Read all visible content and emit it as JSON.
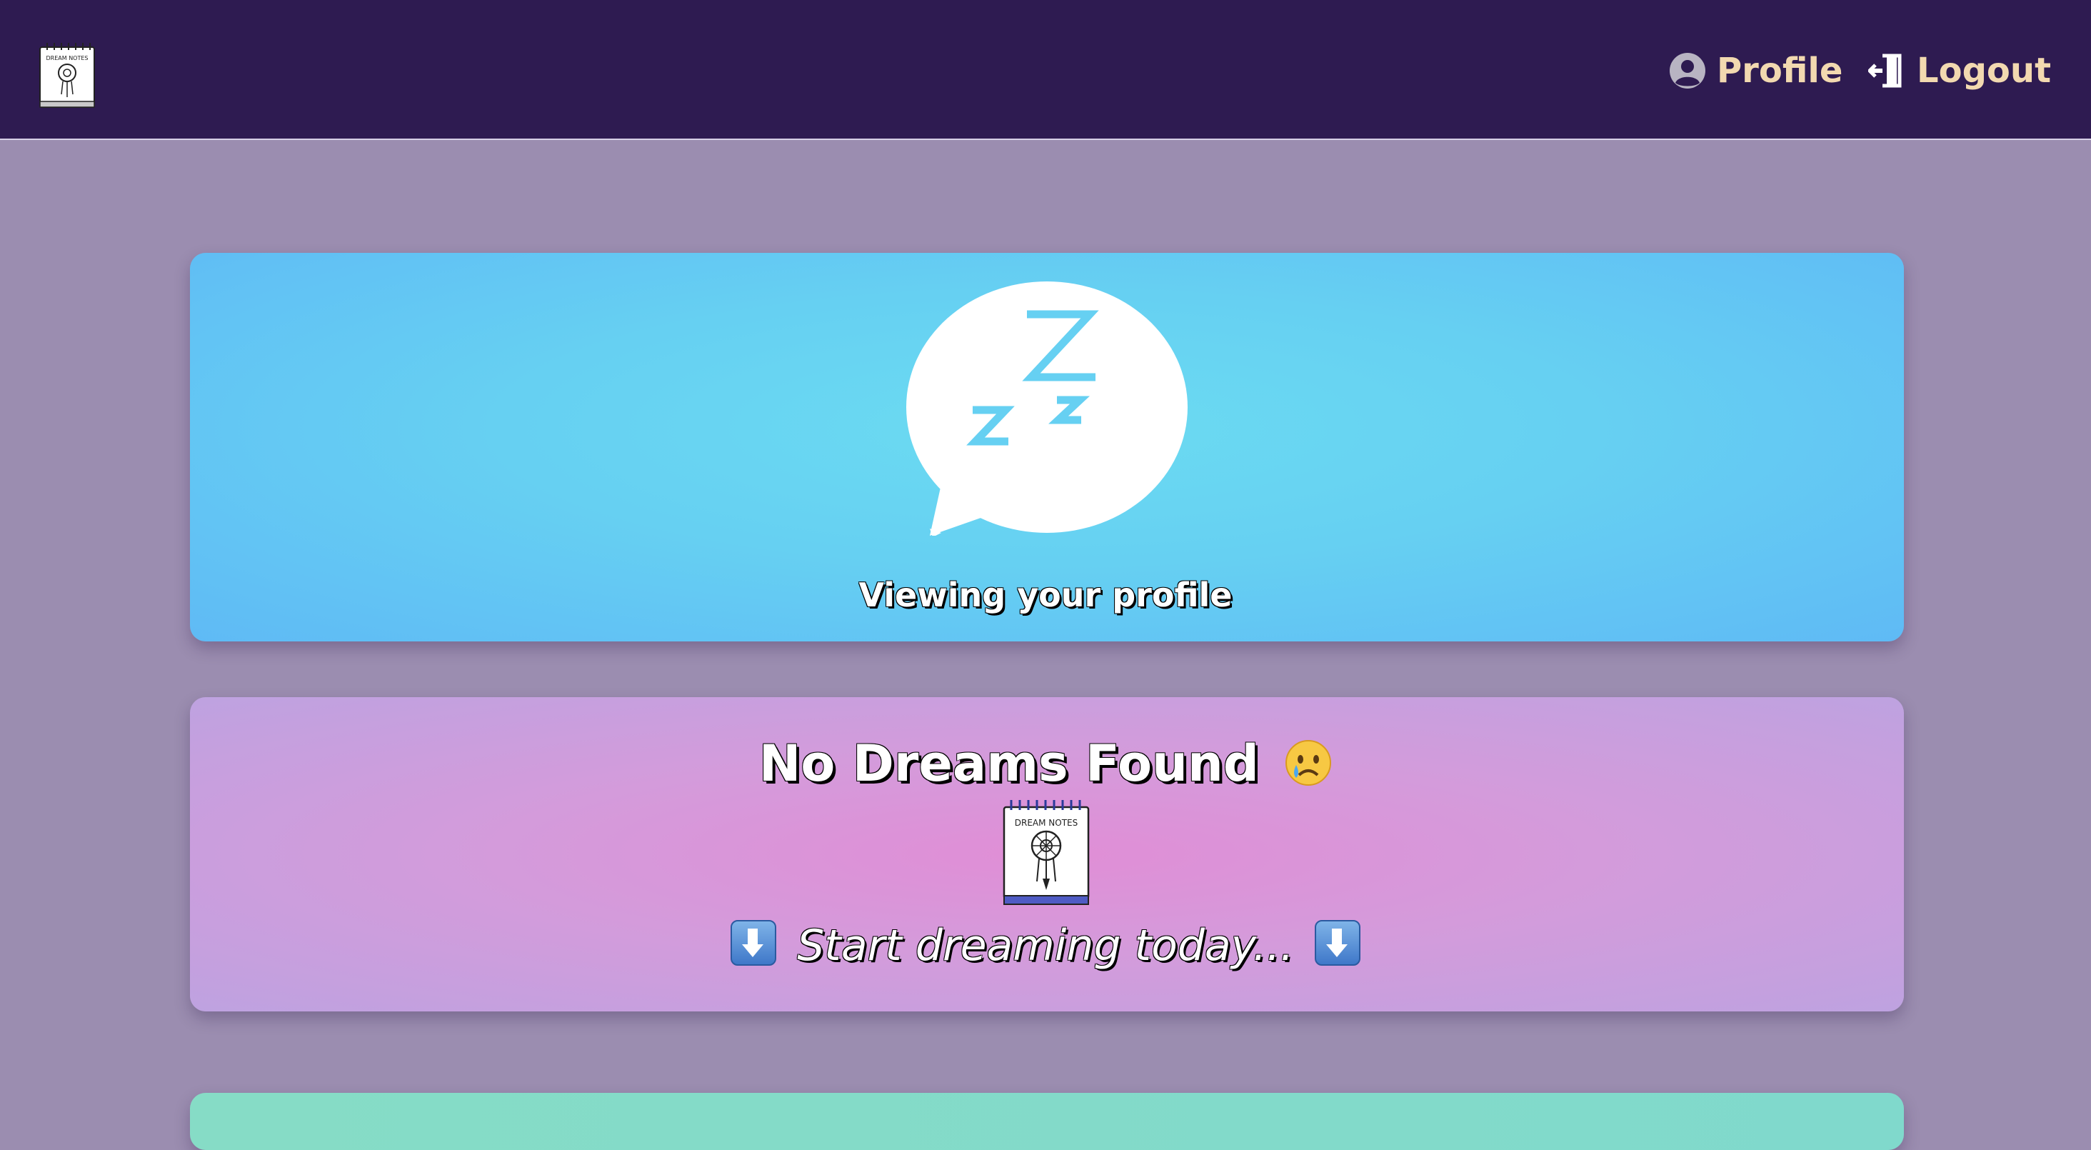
{
  "navbar": {
    "logo_alt": "Dream Notes logo",
    "logo_text": "DREAM NOTES",
    "profile_label": "Profile",
    "logout_label": "Logout",
    "colors": {
      "bar": "#2e1b51",
      "link": "#f2d9b0"
    }
  },
  "profile_card": {
    "icon": "sleeping-zzz-bubble-icon",
    "caption": "Viewing your profile"
  },
  "empty_state": {
    "title": "No Dreams Found",
    "title_emoji": "crying-face-emoji",
    "image_alt": "Dream Notes notebook",
    "image_text": "DREAM NOTES",
    "subtitle": "Start dreaming today...",
    "arrow_icon": "down-arrow-emoji"
  },
  "colors": {
    "page_background": "#9b8db0",
    "profile_card": "#66d0f2",
    "empty_card": "#d49bdb",
    "next_card": "#86dcc6"
  }
}
